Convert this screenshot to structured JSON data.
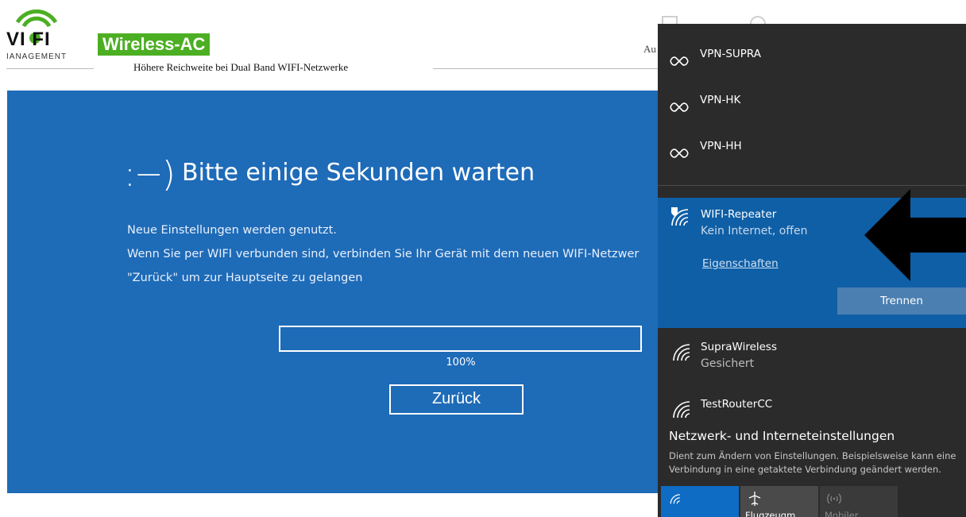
{
  "router_page": {
    "logo_text": "VI   FI",
    "logo_sub": "IANAGEMENT",
    "badge": "Wireless-AC",
    "tagline": "Höhere Reichweite bei Dual Band WIFI-Netzwerke",
    "header_cut_text": "Au",
    "smile": ":−)",
    "title": "Bitte einige Sekunden warten",
    "message_lines": [
      "Neue Einstellungen werden genutzt.",
      "Wenn Sie per WIFI verbunden sind, verbinden Sie Ihr Gerät mit dem neuen WIFI-Netzwer",
      "\"Zurück\" um zur Hauptseite zu gelangen"
    ],
    "progress_percent": 100,
    "progress_text": "100%",
    "back_button": "Zurück",
    "colors": {
      "panel": "#1e6bb8",
      "badge": "#4caf23"
    }
  },
  "flyout": {
    "vpn": [
      {
        "name": "VPN-SUPRA",
        "icon": "vpn-icon"
      },
      {
        "name": "VPN-HK",
        "icon": "vpn-icon"
      },
      {
        "name": "VPN-HH",
        "icon": "vpn-icon"
      }
    ],
    "active_network": {
      "name": "WIFI-Repeater",
      "status": "Kein Internet, offen",
      "properties_link": "Eigenschaften",
      "disconnect_button": "Trennen",
      "icon": "wifi-warning-icon"
    },
    "networks": [
      {
        "name": "SupraWireless",
        "status": "Gesichert",
        "icon": "wifi-icon"
      },
      {
        "name": "TestRouterCC",
        "status": "",
        "icon": "wifi-icon"
      }
    ],
    "settings_title": "Netzwerk- und Interneteinstellungen",
    "settings_desc": "Dient zum Ändern von Einstellungen. Beispielsweise kann eine Verbindung in eine getaktete Verbindung geändert werden.",
    "quick_actions": [
      {
        "label": "",
        "icon": "wifi-icon",
        "active": true
      },
      {
        "label": "Flugzeugm...",
        "icon": "airplane-icon",
        "active": false
      },
      {
        "label": "Mobiler...",
        "icon": "hotspot-icon",
        "active": false
      }
    ],
    "colors": {
      "background": "#2b2b2b",
      "active": "#0f5fa6",
      "button": "#4b7fb1"
    }
  }
}
